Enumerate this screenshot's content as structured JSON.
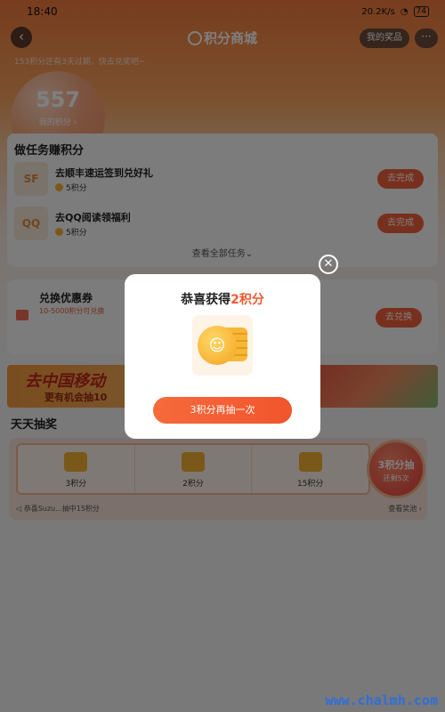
{
  "status": {
    "time": "18:40",
    "net": "20.2K/s",
    "battery": "74"
  },
  "header": {
    "back": "‹",
    "title": "积分商城",
    "prizes_btn": "我的奖品",
    "more": "···"
  },
  "notice": "153积分还有3天过期，快去兑奖吧~",
  "points": {
    "value": "557",
    "label": "我的积分 ›"
  },
  "tasks": {
    "title": "做任务赚积分",
    "items": [
      {
        "logo": "SF",
        "name": "去顺丰速运签到兑好礼",
        "points": "5积分",
        "action": "去完成"
      },
      {
        "logo": "QQ",
        "name": "去QQ阅读领福利",
        "points": "5积分",
        "action": "去完成"
      }
    ],
    "see_all": "查看全部任务"
  },
  "coupon": {
    "title": "兑换优惠券",
    "subtitle": "10-5000积分可兑换",
    "action": "去兑换"
  },
  "banner": {
    "line1": "去中国移动",
    "line2": "更有机会抽10"
  },
  "daily": {
    "title": "天天抽奖",
    "slots": [
      {
        "label": "3积分"
      },
      {
        "label": "2积分"
      },
      {
        "label": "15积分"
      }
    ],
    "draw_line1": "3积分抽",
    "draw_line2": "还剩5次",
    "winner": "恭喜Suzu...抽中15积分",
    "pool": "查看奖池 ›"
  },
  "dialog": {
    "title_prefix": "恭喜获得",
    "title_highlight": "2积分",
    "action": "3积分再抽一次",
    "close": "✕"
  },
  "watermark": "www.chalmh.com"
}
